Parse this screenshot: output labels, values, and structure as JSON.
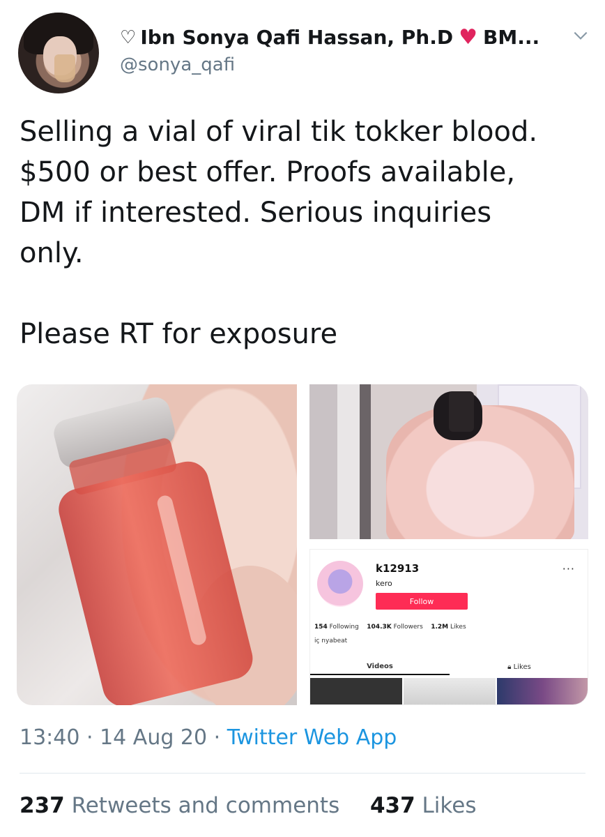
{
  "tweet": {
    "author": {
      "display_name": "Ibn Sonya Qafi Hassan, Ph.D",
      "name_suffix": "BM...",
      "handle": "@sonya_qafi"
    },
    "text_lines": [
      "Selling a vial of viral tik tokker blood.",
      "$500 or best offer. Proofs available,",
      "DM if interested. Serious inquiries",
      "only."
    ],
    "text_line_2": "Please RT for exposure",
    "timestamp": {
      "time": "13:40",
      "date": "14 Aug 20",
      "source": "Twitter Web App"
    },
    "stats": {
      "retweets_count": "237",
      "retweets_label": "Retweets and comments",
      "likes_count": "437",
      "likes_label": "Likes"
    }
  },
  "embedded_profile": {
    "username": "k12913",
    "nickname": "kero",
    "follow_label": "Follow",
    "following_count": "154",
    "following_label": "Following",
    "followers_count": "104.3K",
    "followers_label": "Followers",
    "likes_count": "1.2M",
    "likes_label": "Likes",
    "bio": "iç nyabeat",
    "tab_videos": "Videos",
    "tab_likes": "Likes"
  },
  "colors": {
    "accent_link": "#1b95e0",
    "heart_red": "#e0245e",
    "muted_text": "#657786",
    "follow_button": "#fe2c55"
  }
}
